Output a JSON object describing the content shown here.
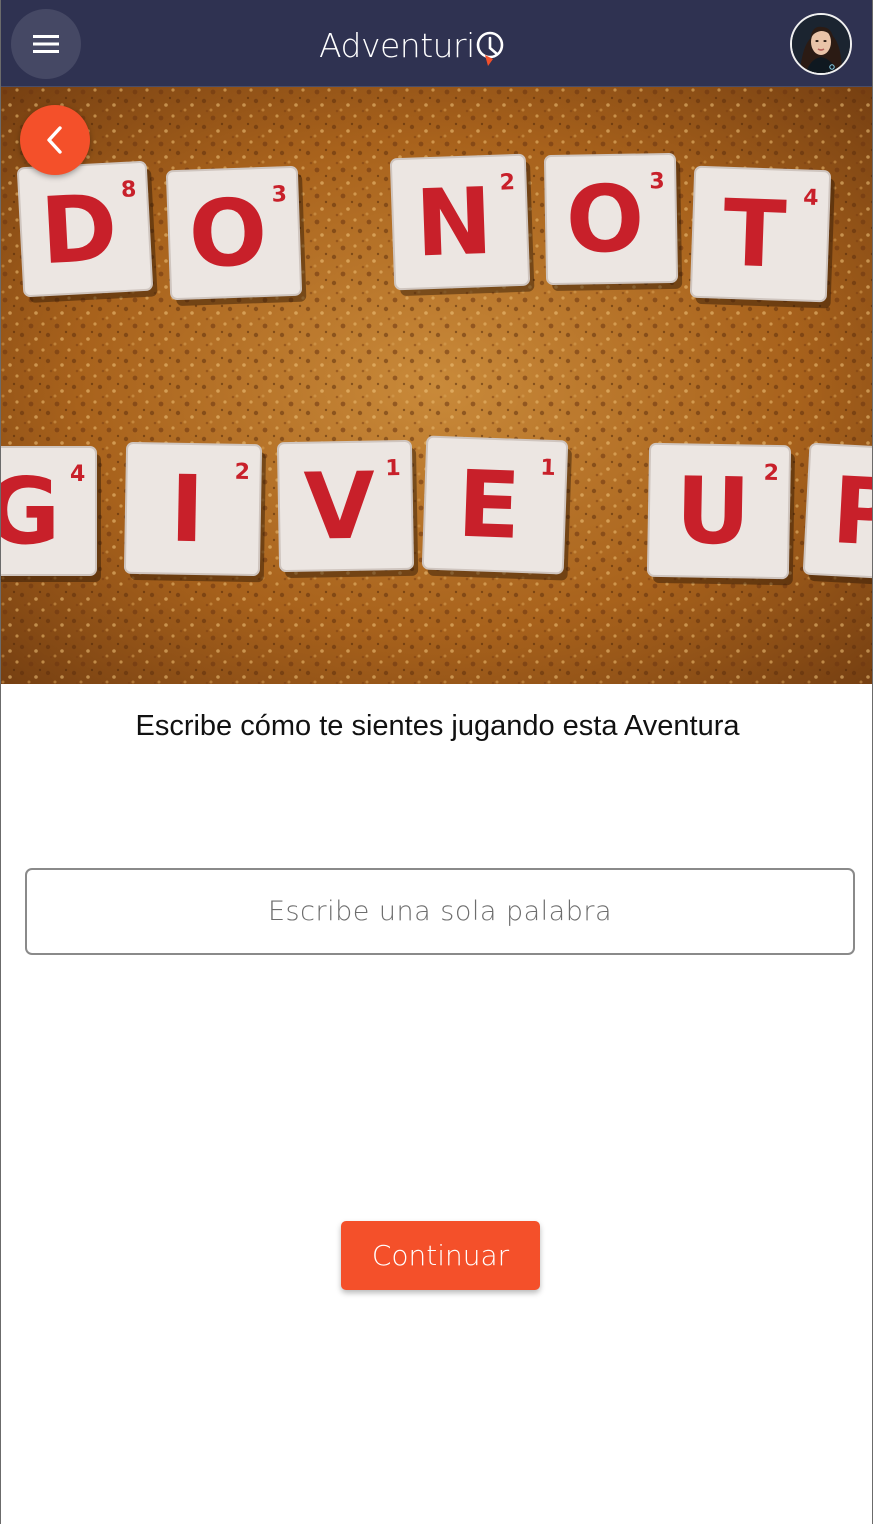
{
  "header": {
    "brand_name": "Adventuri",
    "menu_icon": "menu-icon",
    "avatar_alt": "user-avatar"
  },
  "hero": {
    "tiles_row1": [
      "D",
      "O",
      "N",
      "O",
      "T"
    ],
    "tiles_row2": [
      "G",
      "I",
      "V",
      "E",
      "U",
      "P"
    ],
    "scores_row1": [
      "8",
      "3",
      "2",
      "3",
      "4"
    ],
    "scores_row2": [
      "4",
      "2",
      "1",
      "1",
      "2",
      ""
    ],
    "back_icon": "chevron-left-icon"
  },
  "main": {
    "question": "Escribe cómo te sientes jugando esta Aventura",
    "input_placeholder": "Escribe una sola palabra",
    "input_value": "",
    "continue_label": "Continuar"
  },
  "colors": {
    "header_bg": "#2f3251",
    "accent": "#f4502a",
    "tile_letter": "#c8202a"
  }
}
